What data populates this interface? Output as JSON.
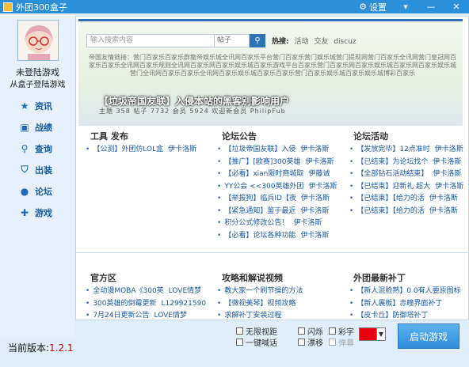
{
  "window": {
    "title": "外团300盒子",
    "settings_label": "设置",
    "minimize": "▾",
    "minimize2": "—",
    "close": "✕"
  },
  "user": {
    "name": "未登陆游戏",
    "subtitle": "从盒子登陆游戏"
  },
  "nav": [
    {
      "label": "资讯",
      "icon": "star-icon",
      "glyph": "★"
    },
    {
      "label": "战绩",
      "icon": "scoreboard-icon",
      "glyph": "▣"
    },
    {
      "label": "查询",
      "icon": "search-icon",
      "glyph": "⚲"
    },
    {
      "label": "出装",
      "icon": "item-bag-icon",
      "glyph": "⛉"
    },
    {
      "label": "论坛",
      "icon": "chat-bubble-icon",
      "glyph": "●"
    },
    {
      "label": "游戏",
      "icon": "gamepad-icon",
      "glyph": "✚"
    }
  ],
  "banner": {
    "search_placeholder": "输入搜索内容",
    "search_select": "帖子",
    "hot_label": "热搜:",
    "hot_tags": [
      "活动",
      "交友",
      "discuz"
    ],
    "text": "帝国友情链接：营门百家乐百家乐群龍帝娱乐城全讯网百家乐平台营门百家乐营门娱乐城营门提现网营门百家乐全讯网营门皇冠网百家乐百家乐全讯网百家乐规则全讯网百家乐网百家乐娱乐城百家乐游戏平台百家乐营门百家乐网百家乐娱乐城百家乐网百家乐娱乐城营门全讯网百家乐百家乐全讯网百家乐娱乐城百家乐百家乐营门百家乐娱乐城百家乐娱乐城博彩百家乐",
    "headline": "【垃圾帝国友联】入侵本站的黑客别影响用户",
    "stats": "主题 358 帖子 7732 会员 5924 欢迎新会员 PhilipFub"
  },
  "sections": {
    "tools": {
      "title": "工具 发布",
      "items": [
        {
          "text": "【公测】外团仿LOL盒",
          "author": "伊卡洛斯"
        }
      ]
    },
    "announce": {
      "title": "论坛公告",
      "items": [
        {
          "text": "【垃圾帝国友联】入侵",
          "author": "伊卡洛斯"
        },
        {
          "text": "【推广】[欧赛]300英雄",
          "author": "伊卡洛斯"
        },
        {
          "text": "【必看】xian限时商城取",
          "author": "伊藤诚"
        },
        {
          "text": "YY公会 <<300英雄外团",
          "author": "伊卡洛斯"
        },
        {
          "text": "【举报狗】临兵ID【夜",
          "author": "伊卡洛斯"
        },
        {
          "text": "【紧急通知】鉴于最近",
          "author": "伊卡洛斯"
        },
        {
          "text": "积分公式修改公告！",
          "author": "伊卡洛斯"
        },
        {
          "text": "【必看】论坛各种功能",
          "author": "伊卡洛斯"
        }
      ]
    },
    "events": {
      "title": "论坛活动",
      "items": [
        {
          "text": "【发放完毕】12点准时",
          "author": "伊卡洛斯"
        },
        {
          "text": "【已结束】为论坛找个",
          "author": "伊卡洛斯"
        },
        {
          "text": "【全部钻石活动结束】",
          "author": "伊卡洛斯"
        },
        {
          "text": "【已结束】迎新礼 超大",
          "author": "伊卡洛斯"
        },
        {
          "text": "【已结束】【给力的活",
          "author": "伊卡洛斯"
        },
        {
          "text": "【已结束】【给力的活",
          "author": "伊卡洛斯"
        }
      ]
    },
    "official": {
      "title": "官方区",
      "items": [
        {
          "text": "全动漫MOBA《300英",
          "author": "LOVE情梦"
        },
        {
          "text": "300英雄的倒霉更新",
          "author": "L129921590"
        },
        {
          "text": "7月24日更新公告",
          "author": "LOVE情梦"
        }
      ]
    },
    "guides": {
      "title": "攻略和解说视频",
      "items": [
        {
          "text": "教大家一个刷节操的方法"
        },
        {
          "text": "【微视美琴】视频攻略"
        },
        {
          "text": "求解补丁安装过程"
        }
      ]
    },
    "patches": {
      "title": "外团最新补丁",
      "items": [
        {
          "text": "【新人混脸熟】0 0有人要原图标"
        },
        {
          "text": "【新人展板】赤瞳界面补丁"
        },
        {
          "text": "【皮卡丘】防御塔补丁"
        }
      ]
    }
  },
  "options": {
    "unlimited_view": "无限视距",
    "one_key_voice": "一键喊话",
    "flash": "闪烁",
    "float": "漂移",
    "color_text": "彩字",
    "barrage": "弹幕"
  },
  "colors": {
    "selected_color": "#e8000f",
    "accent": "#2a8fd8"
  },
  "version": {
    "label": "当前版本:",
    "number": "1.2.1"
  },
  "start_button": "启动游戏"
}
